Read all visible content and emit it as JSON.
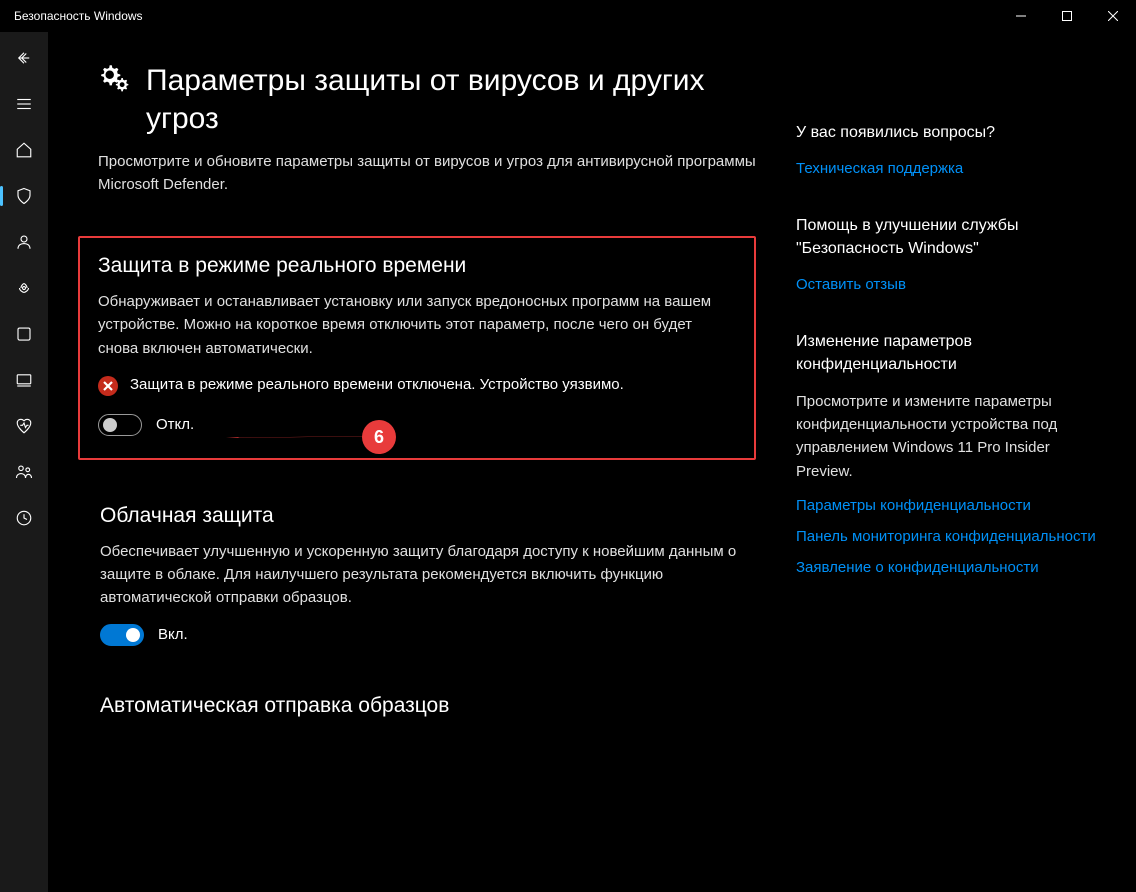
{
  "titlebar": {
    "title": "Безопасность Windows"
  },
  "page": {
    "title": "Параметры защиты от вирусов и других угроз",
    "description": "Просмотрите и обновите параметры защиты от вирусов и угроз для антивирусной программы Microsoft Defender."
  },
  "sections": {
    "realtime": {
      "title": "Защита в режиме реального времени",
      "description": "Обнаруживает и останавливает установку или запуск вредоносных программ на вашем устройстве. Можно на короткое время отключить этот параметр, после чего он будет снова включен автоматически.",
      "alert": "Защита в режиме реального времени отключена. Устройство уязвимо.",
      "toggle_label": "Откл."
    },
    "cloud": {
      "title": "Облачная защита",
      "description": "Обеспечивает улучшенную и ускоренную защиту благодаря доступу к новейшим данным о защите в облаке. Для наилучшего результата рекомендуется включить функцию автоматической отправки образцов.",
      "toggle_label": "Вкл."
    },
    "samples": {
      "title": "Автоматическая отправка образцов"
    }
  },
  "right": {
    "questions": {
      "heading": "У вас появились вопросы?",
      "link": "Техническая поддержка"
    },
    "feedback": {
      "heading": "Помощь в улучшении службы \"Безопасность Windows\"",
      "link": "Оставить отзыв"
    },
    "privacy": {
      "heading": "Изменение параметров конфиденциальности",
      "description": "Просмотрите и измените параметры конфиденциальности устройства под управлением Windows 11 Pro Insider Preview.",
      "link1": "Параметры конфиденциальности",
      "link2": "Панель мониторинга конфиденциальности",
      "link3": "Заявление о конфиденциальности"
    }
  },
  "annotation": {
    "badge": "6"
  }
}
